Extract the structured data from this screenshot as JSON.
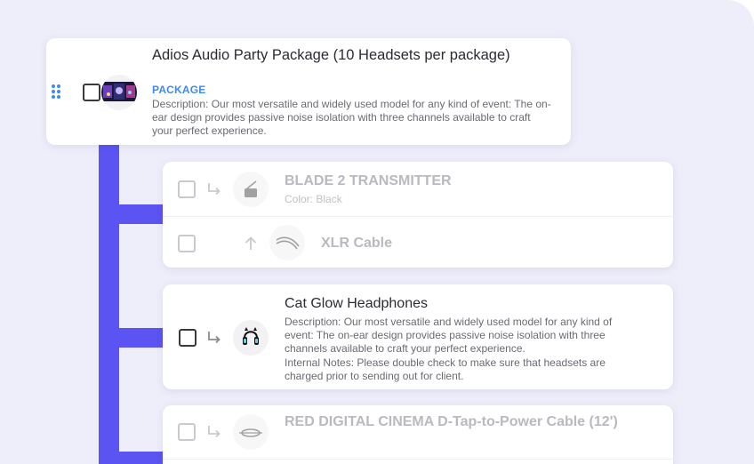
{
  "package": {
    "title": "Adios Audio Party Package (10 Headsets per package)",
    "badge": "PACKAGE",
    "description": "Description: Our most versatile and widely used model for any kind of event: The on-ear design provides passive noise isolation with three channels available to craft your perfect experience."
  },
  "group_a": {
    "item1": {
      "title": "BLADE 2 TRANSMITTER",
      "subtitle": "Color: Black",
      "icon": "transmitter-icon"
    },
    "item2": {
      "title": "XLR Cable",
      "icon": "cable-icon"
    }
  },
  "group_b": {
    "item1": {
      "title": "Cat Glow Headphones",
      "description": "Description: Our most versatile and widely used model for any kind of event: The on-ear design provides passive noise isolation with three channels available to craft your perfect experience.",
      "notes": "Internal Notes: Please double check to make sure that headsets are charged prior to sending out for client.",
      "icon": "headphones-icon"
    }
  },
  "group_c": {
    "item1": {
      "title": "RED DIGITAL CINEMA D-Tap-to-Power Cable (12')",
      "icon": "power-cable-icon"
    }
  },
  "colors": {
    "accent": "#3d8bf0",
    "tree": "#5b54f2",
    "background": "#eeeefb"
  }
}
